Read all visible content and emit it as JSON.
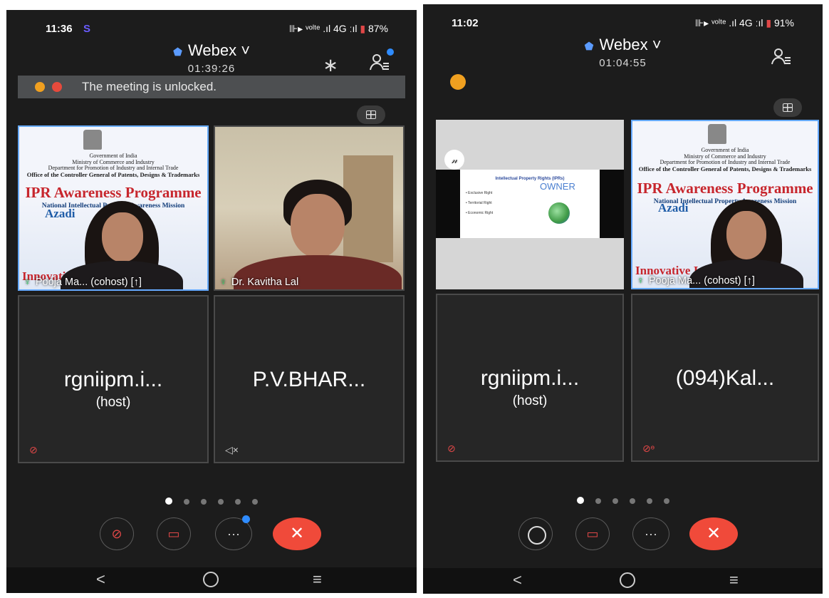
{
  "left": {
    "status": {
      "time": "11:36",
      "extra": "S",
      "indicators": "⊪▸ ᵛᵒˡᵗᵉ .ıl 4G ːıl",
      "battery": "87%"
    },
    "header": {
      "title": "Webex",
      "timer": "01:39:26"
    },
    "banner": {
      "text": "The meeting is unlocked."
    },
    "tiles": [
      {
        "label": "Pooja Ma... (cohost)",
        "share_icon": "[↑]"
      },
      {
        "label": "Dr. Kavitha Lal"
      },
      {
        "name": "rgniipm.i...",
        "sub": "(host)"
      },
      {
        "name": "P.V.BHAR..."
      }
    ],
    "slide": {
      "l1": "Government of India",
      "l2": "Ministry of Commerce and Industry",
      "l3": "Department for Promotion of Industry and Internal Trade",
      "l4": "Office of the Controller General of Patents, Designs & Trademarks",
      "l5": "IPR Awareness Programme",
      "l6": "National Intellectual Property Awareness Mission",
      "l7": "Azadi",
      "l8": "Innovative India"
    },
    "controls": {
      "more": "···",
      "leave": "✕"
    }
  },
  "right": {
    "status": {
      "time": "11:02",
      "indicators": "⊪▸ ᵛᵒˡᵗᵉ .ıl 4G ːıl",
      "battery": "91%"
    },
    "header": {
      "title": "Webex",
      "timer": "01:04:55"
    },
    "shared": {
      "title": "Intellectual Property Rights (IPRs)",
      "items": [
        "• Exclusive Right",
        "• Territorial Right",
        "• Economic Right"
      ],
      "owner": "OWNER"
    },
    "tiles": [
      {
        "label": "Pooja Ma... (cohost)",
        "share_icon": "[↑]"
      },
      {
        "name": "rgniipm.i...",
        "sub": "(host)"
      },
      {
        "name": "(094)Kal..."
      }
    ],
    "controls": {
      "more": "···",
      "leave": "✕"
    }
  },
  "pagination": {
    "count": 6,
    "active": 1
  }
}
